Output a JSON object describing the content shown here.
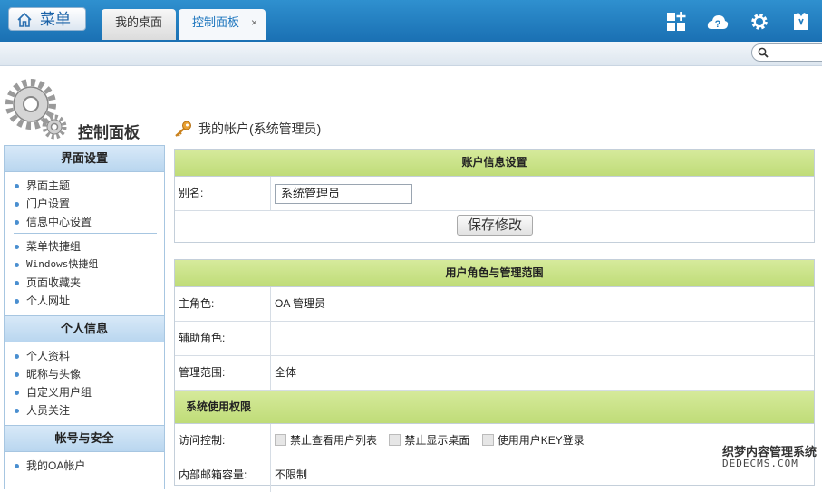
{
  "topbar": {
    "menu_label": "菜单",
    "tabs": [
      {
        "label": "我的桌面"
      },
      {
        "label": "控制面板",
        "close": "×"
      }
    ]
  },
  "sidebar": {
    "title": "控制面板",
    "sections": [
      {
        "title": "界面设置",
        "groups": [
          [
            "界面主题",
            "门户设置",
            "信息中心设置"
          ],
          [
            "菜单快捷组",
            "Windows快捷组",
            "页面收藏夹",
            "个人网址"
          ]
        ]
      },
      {
        "title": "个人信息",
        "items": [
          "个人资料",
          "昵称与头像",
          "自定义用户组",
          "人员关注"
        ]
      },
      {
        "title": "帐号与安全",
        "items": [
          "我的OA帐户"
        ]
      }
    ]
  },
  "main": {
    "page_title": "我的帐户(系统管理员)",
    "account_box": {
      "header": "账户信息设置",
      "alias_label": "别名:",
      "alias_value": "系统管理员",
      "save_label": "保存修改"
    },
    "role_box": {
      "header": "用户角色与管理范围",
      "rows": [
        {
          "label": "主角色:",
          "value": "OA 管理员"
        },
        {
          "label": "辅助角色:",
          "value": ""
        },
        {
          "label": "管理范围:",
          "value": "全体"
        }
      ],
      "perm_header": "系统使用权限",
      "access_label": "访问控制:",
      "access_options": [
        "禁止查看用户列表",
        "禁止显示桌面",
        "使用用户KEY登录"
      ],
      "mailbox_label": "内部邮箱容量:",
      "mailbox_value": "不限制"
    }
  },
  "watermark": {
    "line1": "织梦内容管理系统",
    "line2": "DEDECMS.COM"
  },
  "colors": {
    "topbar": "#1f7bbf",
    "green_header": "#c6e184",
    "blue_header": "#c6def3"
  }
}
